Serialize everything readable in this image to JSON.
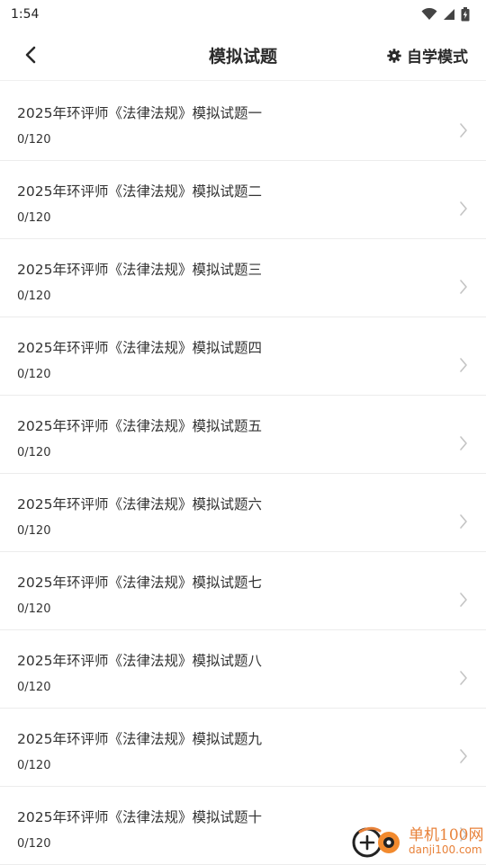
{
  "status_bar": {
    "time": "1:54",
    "icons": [
      "wifi-icon",
      "signal-icon",
      "battery-icon"
    ]
  },
  "header": {
    "back_icon": "chevron-left-icon",
    "title": "模拟试题",
    "mode_icon": "gear-icon",
    "mode_label": "自学模式"
  },
  "list": {
    "items": [
      {
        "title": "2025年环评师《法律法规》模拟试题一",
        "progress": "0/120"
      },
      {
        "title": "2025年环评师《法律法规》模拟试题二",
        "progress": "0/120"
      },
      {
        "title": "2025年环评师《法律法规》模拟试题三",
        "progress": "0/120"
      },
      {
        "title": "2025年环评师《法律法规》模拟试题四",
        "progress": "0/120"
      },
      {
        "title": "2025年环评师《法律法规》模拟试题五",
        "progress": "0/120"
      },
      {
        "title": "2025年环评师《法律法规》模拟试题六",
        "progress": "0/120"
      },
      {
        "title": "2025年环评师《法律法规》模拟试题七",
        "progress": "0/120"
      },
      {
        "title": "2025年环评师《法律法规》模拟试题八",
        "progress": "0/120"
      },
      {
        "title": "2025年环评师《法律法规》模拟试题九",
        "progress": "0/120"
      },
      {
        "title": "2025年环评师《法律法规》模拟试题十",
        "progress": "0/120"
      }
    ]
  },
  "watermark": {
    "name": "单机100网",
    "domain": "danji100.com"
  },
  "colors": {
    "text": "#333333",
    "divider": "#ececec",
    "chevron": "#c4c4c4",
    "watermark": "#e8823a"
  }
}
